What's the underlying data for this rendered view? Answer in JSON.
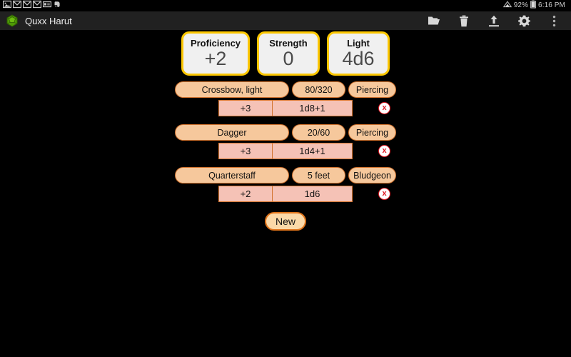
{
  "status_bar": {
    "left_icons": [
      {
        "name": "photo-icon",
        "glyph": "image"
      },
      {
        "name": "gmail-icon-1",
        "glyph": "mail"
      },
      {
        "name": "gmail-icon-2",
        "glyph": "mail"
      },
      {
        "name": "gmail-icon-3",
        "glyph": "mail"
      },
      {
        "name": "contact-card-icon",
        "glyph": "card"
      },
      {
        "name": "evernote-icon",
        "glyph": "elephant"
      }
    ],
    "wifi_icon": "wifi-icon",
    "battery_percent": "92%",
    "battery_icon": "battery-icon",
    "time": "6:16 PM"
  },
  "title_bar": {
    "app_icon": "d20-dice-icon",
    "title": "Quxx Harut",
    "actions": [
      {
        "name": "open-folder-button",
        "icon": "folder-icon"
      },
      {
        "name": "delete-button",
        "icon": "trash-icon"
      },
      {
        "name": "upload-button",
        "icon": "upload-icon"
      },
      {
        "name": "settings-button",
        "icon": "gear-icon"
      },
      {
        "name": "overflow-menu-button",
        "icon": "more-vertical-icon"
      }
    ]
  },
  "stats": [
    {
      "label": "Proficiency",
      "value": "+2"
    },
    {
      "label": "Strength",
      "value": "0"
    },
    {
      "label": "Light",
      "value": "4d6"
    }
  ],
  "weapons": [
    {
      "name": "Crossbow, light",
      "range": "80/320",
      "damage_type": "Piercing",
      "attack_bonus": "+3",
      "damage": "1d8+1",
      "delete_label": "x"
    },
    {
      "name": "Dagger",
      "range": "20/60",
      "damage_type": "Piercing",
      "attack_bonus": "+3",
      "damage": "1d4+1",
      "delete_label": "x"
    },
    {
      "name": "Quarterstaff",
      "range": "5 feet",
      "damage_type": "Bludgeon",
      "attack_bonus": "+2",
      "damage": "1d6",
      "delete_label": "x"
    }
  ],
  "new_button": {
    "label": "New"
  },
  "colors": {
    "background": "#000000",
    "title_bar": "#212121",
    "stat_border": "#fcc700",
    "stat_fill": "#f0f0f0",
    "pill_fill": "#f6c89c",
    "pill_border": "#d2732e",
    "slab_fill": "#f5c2b6",
    "delete_red": "#e01b24",
    "new_border": "#e0741a",
    "new_fill": "#fbd9a8",
    "app_icon_green": "#4e9a06"
  }
}
